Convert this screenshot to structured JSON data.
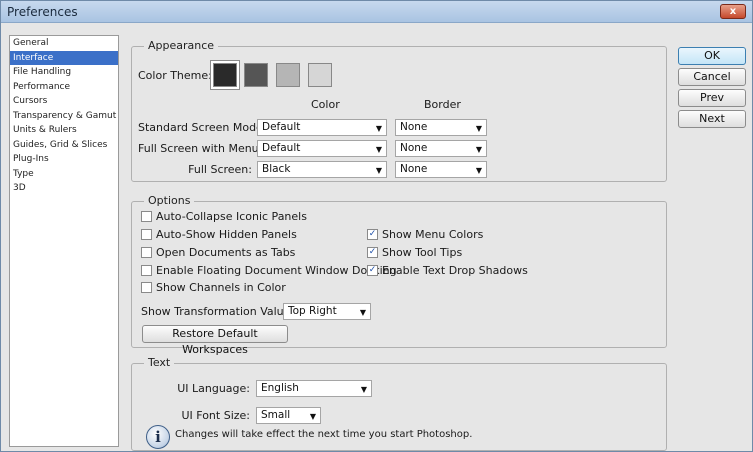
{
  "window": {
    "title": "Preferences",
    "close_label": "x"
  },
  "categories": [
    {
      "label": "General",
      "selected": false
    },
    {
      "label": "Interface",
      "selected": true
    },
    {
      "label": "File Handling",
      "selected": false
    },
    {
      "label": "Performance",
      "selected": false
    },
    {
      "label": "Cursors",
      "selected": false
    },
    {
      "label": "Transparency & Gamut",
      "selected": false
    },
    {
      "label": "Units & Rulers",
      "selected": false
    },
    {
      "label": "Guides, Grid & Slices",
      "selected": false
    },
    {
      "label": "Plug-Ins",
      "selected": false
    },
    {
      "label": "Type",
      "selected": false
    },
    {
      "label": "3D",
      "selected": false
    }
  ],
  "appearance": {
    "legend": "Appearance",
    "color_theme_label": "Color Theme:",
    "swatch_colors": [
      "#2a2a2a",
      "#555555",
      "#b5b5b5",
      "#d6d6d6"
    ],
    "color_header": "Color",
    "border_header": "Border",
    "rows": [
      {
        "label": "Standard Screen Mode:",
        "color": "Default",
        "border": "None"
      },
      {
        "label": "Full Screen with Menus:",
        "color": "Default",
        "border": "None"
      },
      {
        "label": "Full Screen:",
        "color": "Black",
        "border": "None"
      }
    ]
  },
  "options": {
    "legend": "Options",
    "auto_collapse": {
      "label": "Auto-Collapse Iconic Panels",
      "checked": false
    },
    "auto_show": {
      "label": "Auto-Show Hidden Panels",
      "checked": false
    },
    "open_tabs": {
      "label": "Open Documents as Tabs",
      "checked": false
    },
    "floating_docking": {
      "label": "Enable Floating Document Window Docking",
      "checked": false
    },
    "channels_color": {
      "label": "Show Channels in Color",
      "checked": false
    },
    "menu_colors": {
      "label": "Show Menu Colors",
      "checked": true
    },
    "tool_tips": {
      "label": "Show Tool Tips",
      "checked": true
    },
    "text_shadows": {
      "label": "Enable Text Drop Shadows",
      "checked": true
    },
    "transform_label": "Show Transformation Values:",
    "transform_value": "Top Right",
    "restore_label": "Restore Default Workspaces"
  },
  "text_section": {
    "legend": "Text",
    "ui_language_label": "UI Language:",
    "ui_language_value": "English",
    "ui_font_size_label": "UI Font Size:",
    "ui_font_size_value": "Small",
    "notice": "Changes will take effect the next time you start Photoshop."
  },
  "buttons": {
    "ok": "OK",
    "cancel": "Cancel",
    "prev": "Prev",
    "next": "Next"
  },
  "check_glyph": "✓",
  "arrow_glyph": "▼",
  "info_glyph": "i"
}
